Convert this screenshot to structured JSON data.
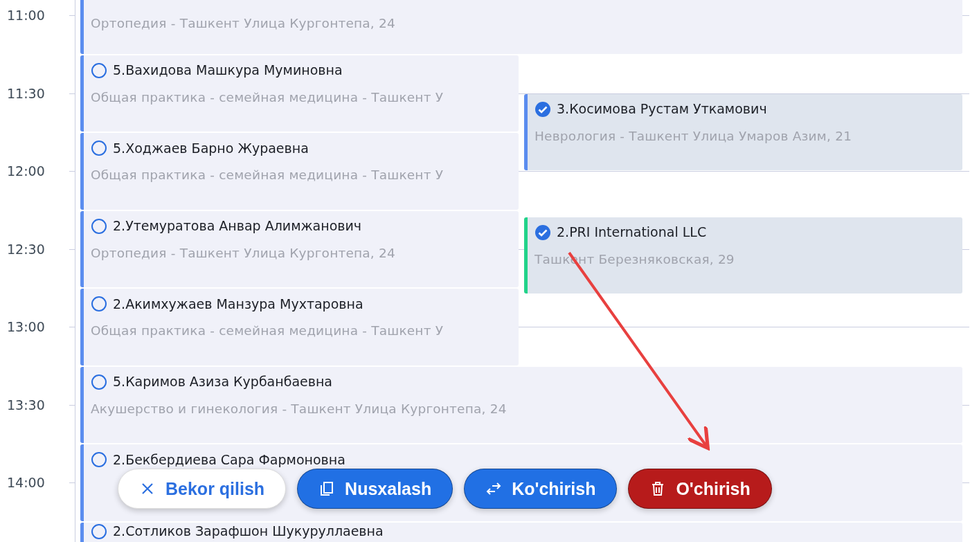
{
  "time_labels": [
    "11:00",
    "11:30",
    "12:00",
    "12:30",
    "13:00",
    "13:30",
    "14:00"
  ],
  "events": [
    {
      "subtitle": "Ортопедия - Ташкент Улица Кургонтепа, 24",
      "color": "#5b8def"
    },
    {
      "title": "5.Вахидова Машкура Муминовна",
      "subtitle": "Общая практика - семейная медицина - Ташкент У",
      "selected": false,
      "color": "#5b8def"
    },
    {
      "title": "5.Ходжаев Барно Жураевна",
      "subtitle": "Общая практика - семейная медицина - Ташкент У",
      "selected": false,
      "color": "#5b8def"
    },
    {
      "title": "2.Утемуратова Анвар Алимжанович",
      "subtitle": "Ортопедия - Ташкент Улица Кургонтепа, 24",
      "selected": false,
      "color": "#5b8def"
    },
    {
      "title": "2.Акимхужаев Манзура Мухтаровна",
      "subtitle": "Общая практика - семейная медицина - Ташкент У",
      "selected": false,
      "color": "#5b8def"
    },
    {
      "title": "5.Каримов Азиза Курбанбаевна",
      "subtitle": "Акушерство и гинекология - Ташкент Улица Кургонтепа, 24",
      "selected": false,
      "color": "#5b8def"
    },
    {
      "title": "2.Бекбердиева Сара Фармоновна",
      "selected": false,
      "color": "#5b8def"
    },
    {
      "title": "2.Сотликов Зарафшон Шукуруллаевна",
      "selected": false,
      "color": "#5b8def"
    },
    {
      "title": "3.Косимова Рустам Уткамович",
      "subtitle": "Неврология - Ташкент Улица Умаров Азим, 21",
      "selected": true,
      "color": "#5b8def"
    },
    {
      "title": "2.PRI International LLC",
      "subtitle": "Ташкент  Березняковская, 29",
      "selected": true,
      "color": "#22d38a"
    }
  ],
  "actions": [
    {
      "kind": "cancel",
      "label": "Bekor qilish"
    },
    {
      "kind": "copy",
      "label": "Nusxalash"
    },
    {
      "kind": "move",
      "label": "Ko'chirish"
    },
    {
      "kind": "delete",
      "label": "O'chirish"
    }
  ]
}
